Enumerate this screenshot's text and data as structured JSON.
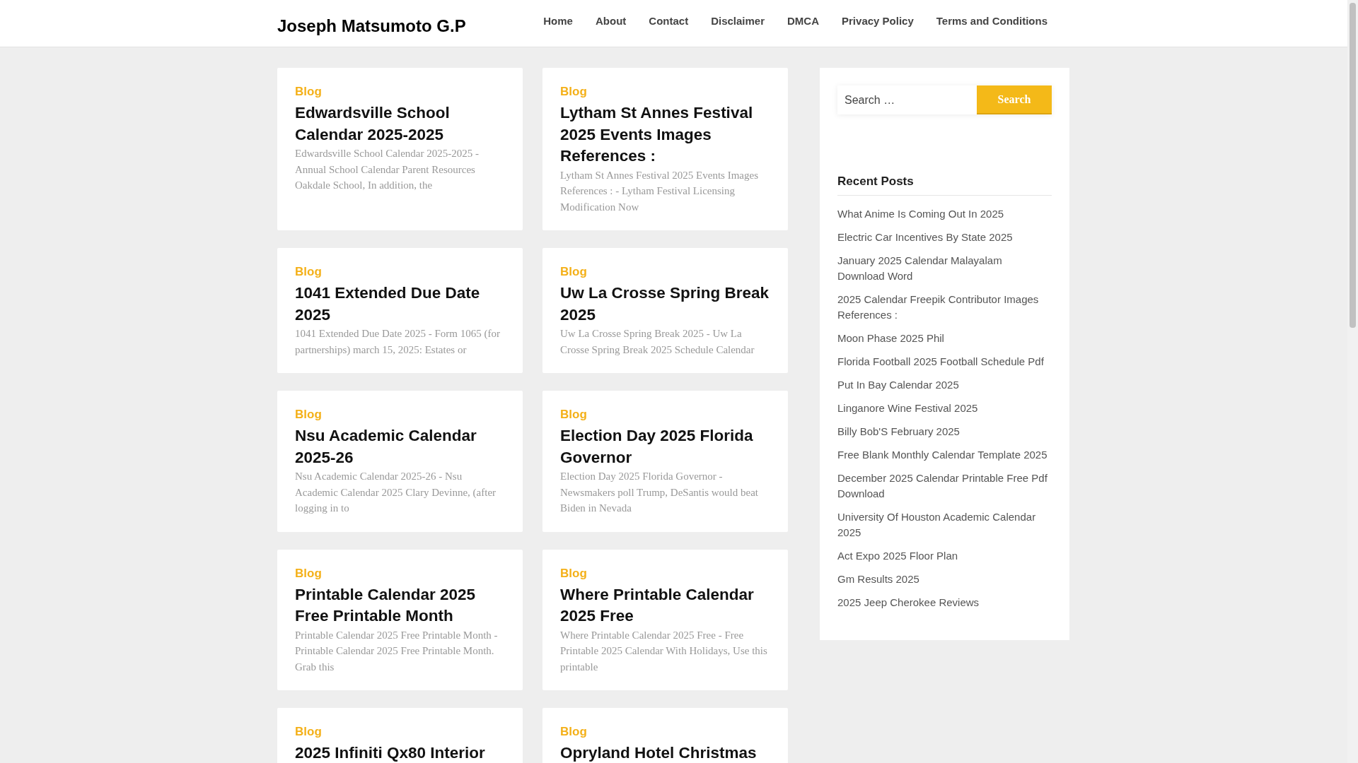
{
  "site_title": "Joseph Matsumoto G.P",
  "nav": [
    "Home",
    "About",
    "Contact",
    "Disclaimer",
    "DMCA",
    "Privacy Policy",
    "Terms and Conditions"
  ],
  "posts": [
    {
      "category": "Blog",
      "title": "Edwardsville School Calendar 2025-2025",
      "excerpt": "Edwardsville School Calendar 2025-2025 - Annual School Calendar Parent Resources Oakdale School, In addition, the"
    },
    {
      "category": "Blog",
      "title": "Lytham St Annes Festival 2025 Events Images References :",
      "excerpt": "Lytham St Annes Festival 2025 Events Images References : - Lytham Festival Licensing Modification Now"
    },
    {
      "category": "Blog",
      "title": "1041 Extended Due Date 2025",
      "excerpt": "1041 Extended Due Date 2025 - Form 1065 (for partnerships) march 15, 2025: Estates or"
    },
    {
      "category": "Blog",
      "title": "Uw La Crosse Spring Break 2025",
      "excerpt": "Uw La Crosse Spring Break 2025 - Uw La Crosse Spring Break 2025 Schedule Calendar"
    },
    {
      "category": "Blog",
      "title": "Nsu Academic Calendar 2025-26",
      "excerpt": "Nsu Academic Calendar 2025-26 - Nsu Academic Calendar 2025 Clary Devinne, (after logging in to"
    },
    {
      "category": "Blog",
      "title": "Election Day 2025 Florida Governor",
      "excerpt": "Election Day 2025 Florida Governor - Newsmakers poll Trump, DeSantis would beat Biden in Nevada"
    },
    {
      "category": "Blog",
      "title": "Printable Calendar 2025 Free Printable Month",
      "excerpt": "Printable Calendar 2025 Free Printable Month - Printable Calendar 2025 Free Printable Month. Grab this"
    },
    {
      "category": "Blog",
      "title": "Where Printable Calendar 2025 Free",
      "excerpt": "Where Printable Calendar 2025 Free - Free Printable 2025 Calendar With Holidays, Use this printable"
    },
    {
      "category": "Blog",
      "title": "2025 Infiniti Qx80 Interior"
    },
    {
      "category": "Blog",
      "title": "Opryland Hotel Christmas"
    }
  ],
  "search": {
    "placeholder": "Search …",
    "button": "Search"
  },
  "recent_posts": {
    "heading": "Recent Posts",
    "items": [
      "What Anime Is Coming Out In 2025",
      "Electric Car Incentives By State 2025",
      "January 2025 Calendar Malayalam Download Word",
      "2025 Calendar Freepik Contributor Images References :",
      "Moon Phase 2025 Phil",
      "Florida Football 2025 Football Schedule Pdf",
      "Put In Bay Calendar 2025",
      "Linganore Wine Festival 2025",
      "Billy Bob'S February 2025",
      "Free Blank Monthly Calendar Template 2025",
      "December 2025 Calendar Printable Free Pdf Download",
      "University Of Houston Academic Calendar 2025",
      "Act Expo 2025 Floor Plan",
      "Gm Results 2025",
      "2025 Jeep Cherokee Reviews"
    ]
  }
}
